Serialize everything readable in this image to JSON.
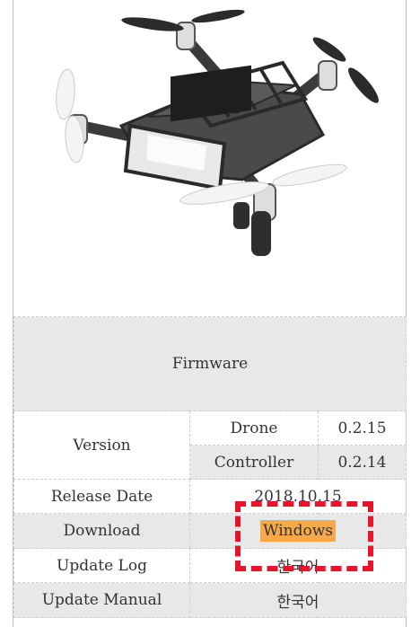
{
  "product": {
    "image_alt": "quadcopter-drone"
  },
  "table": {
    "header": "Firmware",
    "version_label": "Version",
    "drone_label": "Drone",
    "drone_version": "0.2.15",
    "controller_label": "Controller",
    "controller_version": "0.2.14",
    "release_label": "Release Date",
    "release_value": "2018.10.15",
    "download_label": "Download",
    "download_value": "Windows",
    "update_log_label": "Update Log",
    "update_log_value": "한국어",
    "update_manual_label": "Update Manual",
    "update_manual_value": "한국어"
  },
  "colors": {
    "highlight": "#e8152a",
    "button": "#f5a94a",
    "link": "#4a6fa5"
  }
}
